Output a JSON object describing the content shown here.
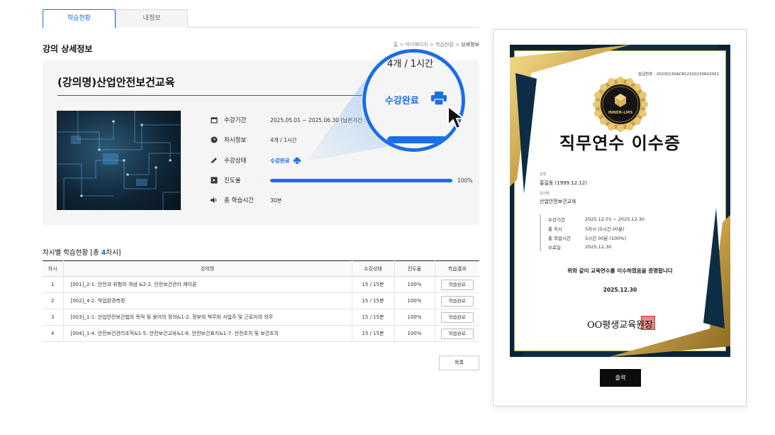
{
  "tabs": [
    "학습현황",
    "내정보"
  ],
  "section_title": "강의 상세정보",
  "breadcrumb": {
    "home": "홈",
    "sep": ">",
    "items": [
      "마이페이지",
      "학습현황"
    ],
    "current": "상세정보"
  },
  "course": {
    "title": "(강의명)산업안전보건교육",
    "rows": {
      "period": {
        "label": "수강기간",
        "value": "2025.05.01 ~ 2025.06.30 (남은기간 : 30"
      },
      "sessions": {
        "label": "차시정보",
        "value": "4개 / 1시간"
      },
      "status": {
        "label": "수강상태",
        "value": "수강완료"
      },
      "progress": {
        "label": "진도율",
        "value": "100%",
        "fraction": 1.0
      },
      "total_time": {
        "label": "총 학습시간",
        "value": "30분"
      }
    }
  },
  "magnifier": {
    "top_text": "4개 / 1시간",
    "status": "수강완료"
  },
  "table": {
    "title_prefix": "차시별 학습현황",
    "title_count_pre": "[총 ",
    "title_count": "4",
    "title_count_post": "차시]",
    "headers": [
      "차시",
      "강의명",
      "수강상태",
      "진도율",
      "학습결과"
    ],
    "rows": [
      {
        "no": "1",
        "name": "[001]_2-1. 안전과 위험의 개념 &2-2. 안전보건관리 체이론",
        "status": "15 / 15분",
        "progress": "100%",
        "result": "학습완료"
      },
      {
        "no": "2",
        "name": "[002]_4-2. 작업환경측정",
        "status": "15 / 15분",
        "progress": "100%",
        "result": "학습완료"
      },
      {
        "no": "3",
        "name": "[003]_1-1. 산업안전보건법의 목적 및 용어의 정의&1-2. 정부의 책무와 사업주 및 근로자의 의무",
        "status": "15 / 15분",
        "progress": "100%",
        "result": "학습완료"
      },
      {
        "no": "4",
        "name": "[004]_1-4. 안전보건관리조직&1-5. 안전보건교육&1-6. 안전보건표지&1-7. 안전조치 및 보건조치",
        "status": "15 / 15분",
        "progress": "100%",
        "result": "학습완료"
      }
    ],
    "list_button": "목록"
  },
  "certificate": {
    "issue_no": "발급번호 : 20230130ACB12320230602001",
    "seal_text": "INNER-LMS",
    "title": "직무연수 이수증",
    "name_label": "성명",
    "name_value": "홍길동 (1999.12.12)",
    "course_label": "강의명",
    "course_value": "산업안전보건교육",
    "details": [
      {
        "k": "수강기간",
        "v": "2025.12.01 ~ 2025.12.30"
      },
      {
        "k": "총 차시",
        "v": "5차시 (5시간 00분)"
      },
      {
        "k": "총 학습시간",
        "v": "5시간 00분 (100%)"
      },
      {
        "k": "수료일",
        "v": "2025.12.30"
      }
    ],
    "statement": "위와 같이 교육연수를 이수하였음을 증명합니다",
    "date": "2025.12.30",
    "issuer": "OO평생교육원장",
    "print_button": "출력"
  },
  "colors": {
    "accent": "#1a6ee6",
    "navy": "#0d2d45",
    "gold": "#c9a14a"
  },
  "icons": {
    "period": "calendar-icon",
    "sessions": "clock-icon",
    "status": "pencil-icon",
    "progress": "play-list-icon",
    "total_time": "speaker-icon",
    "print": "printer-icon"
  }
}
